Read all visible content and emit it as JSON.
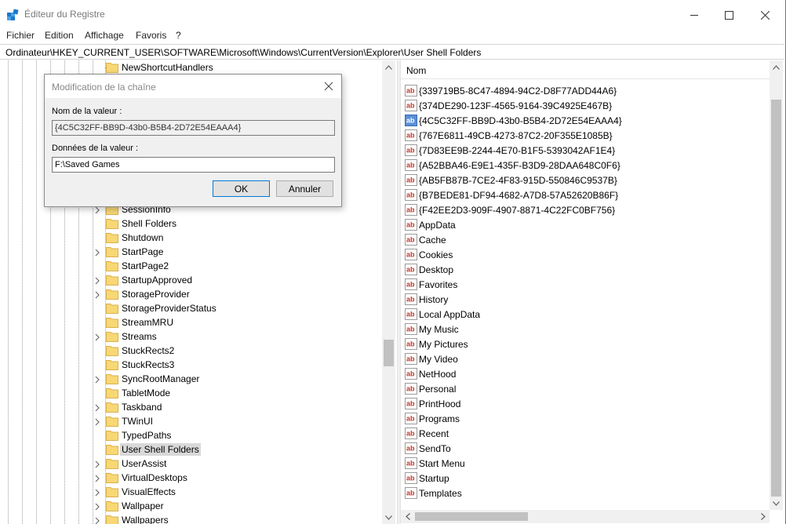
{
  "window": {
    "title": "Éditeur du Registre",
    "controls": [
      "minimize",
      "maximize",
      "close"
    ]
  },
  "menu": [
    "Fichier",
    "Edition",
    "Affichage",
    "Favoris",
    "?"
  ],
  "address": "Ordinateur\\HKEY_CURRENT_USER\\SOFTWARE\\Microsoft\\Windows\\CurrentVersion\\Explorer\\User Shell Folders",
  "tree": {
    "items": [
      {
        "label": "NewShortcutHandlers",
        "expandable": false,
        "selected": false
      },
      {
        "label": "SessionInfo",
        "expandable": true,
        "selected": false
      },
      {
        "label": "Shell Folders",
        "expandable": false,
        "selected": false
      },
      {
        "label": "Shutdown",
        "expandable": false,
        "selected": false
      },
      {
        "label": "StartPage",
        "expandable": true,
        "selected": false
      },
      {
        "label": "StartPage2",
        "expandable": false,
        "selected": false
      },
      {
        "label": "StartupApproved",
        "expandable": true,
        "selected": false
      },
      {
        "label": "StorageProvider",
        "expandable": true,
        "selected": false
      },
      {
        "label": "StorageProviderStatus",
        "expandable": false,
        "selected": false
      },
      {
        "label": "StreamMRU",
        "expandable": false,
        "selected": false
      },
      {
        "label": "Streams",
        "expandable": true,
        "selected": false
      },
      {
        "label": "StuckRects2",
        "expandable": false,
        "selected": false
      },
      {
        "label": "StuckRects3",
        "expandable": false,
        "selected": false
      },
      {
        "label": "SyncRootManager",
        "expandable": true,
        "selected": false
      },
      {
        "label": "TabletMode",
        "expandable": false,
        "selected": false
      },
      {
        "label": "Taskband",
        "expandable": true,
        "selected": false
      },
      {
        "label": "TWinUI",
        "expandable": true,
        "selected": false
      },
      {
        "label": "TypedPaths",
        "expandable": false,
        "selected": false
      },
      {
        "label": "User Shell Folders",
        "expandable": false,
        "selected": true
      },
      {
        "label": "UserAssist",
        "expandable": true,
        "selected": false
      },
      {
        "label": "VirtualDesktops",
        "expandable": true,
        "selected": false
      },
      {
        "label": "VisualEffects",
        "expandable": true,
        "selected": false
      },
      {
        "label": "Wallpaper",
        "expandable": true,
        "selected": false
      },
      {
        "label": "Wallpapers",
        "expandable": true,
        "selected": false
      }
    ]
  },
  "list": {
    "column_header": "Nom",
    "items": [
      "{339719B5-8C47-4894-94C2-D8F77ADD44A6}",
      "{374DE290-123F-4565-9164-39C4925E467B}",
      "{4C5C32FF-BB9D-43b0-B5B4-2D72E54EAAA4}",
      "{767E6811-49CB-4273-87C2-20F355E1085B}",
      "{7D83EE9B-2244-4E70-B1F5-5393042AF1E4}",
      "{A52BBA46-E9E1-435F-B3D9-28DAA648C0F6}",
      "{AB5FB87B-7CE2-4F83-915D-550846C9537B}",
      "{B7BEDE81-DF94-4682-A7D8-57A52620B86F}",
      "{F42EE2D3-909F-4907-8871-4C22FC0BF756}",
      "AppData",
      "Cache",
      "Cookies",
      "Desktop",
      "Favorites",
      "History",
      "Local AppData",
      "My Music",
      "My Pictures",
      "My Video",
      "NetHood",
      "Personal",
      "PrintHood",
      "Programs",
      "Recent",
      "SendTo",
      "Start Menu",
      "Startup",
      "Templates"
    ],
    "highlighted_index": 2
  },
  "dialog": {
    "title": "Modification de la chaîne",
    "value_name_label": "Nom de la valeur :",
    "value_name": "{4C5C32FF-BB9D-43b0-B5B4-2D72E54EAAA4}",
    "value_data_label": "Données de la valeur :",
    "value_data": "F:\\Saved Games",
    "ok_label": "OK",
    "cancel_label": "Annuler"
  },
  "colors": {
    "accent": "#0078d7",
    "folder": "#f8d775",
    "string_icon_red": "#c0392b",
    "selection": "#d9d9d9"
  }
}
